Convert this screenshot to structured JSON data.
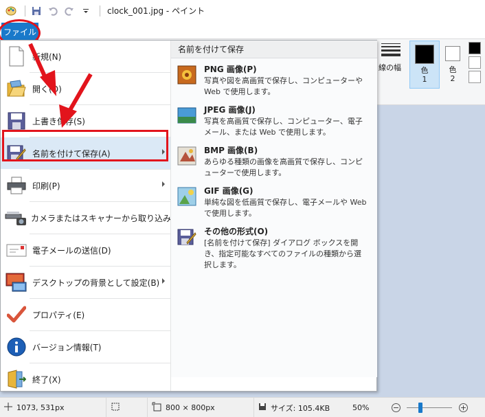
{
  "window": {
    "title": "clock_001.jpg - ペイント"
  },
  "ribbon": {
    "line_width_label": "線の幅",
    "color1_label": "色",
    "color1_num": "1",
    "color2_label": "色",
    "color2_num": "2"
  },
  "file_tab": {
    "label": "ファイル"
  },
  "menu": {
    "items": [
      {
        "label": "新規(N)",
        "icon": "new-file-icon"
      },
      {
        "label": "開く(O)",
        "icon": "open-folder-icon"
      },
      {
        "label": "上書き保存(S)",
        "icon": "save-icon"
      },
      {
        "label": "名前を付けて保存(A)",
        "icon": "save-as-icon",
        "submenu": true,
        "selected": true
      },
      {
        "label": "印刷(P)",
        "icon": "printer-icon",
        "submenu": true
      },
      {
        "label": "カメラまたはスキャナーから取り込み(M)",
        "icon": "scanner-icon"
      },
      {
        "label": "電子メールの送信(D)",
        "icon": "email-icon"
      },
      {
        "label": "デスクトップの背景として設定(B)",
        "icon": "desktop-background-icon",
        "submenu": true
      },
      {
        "label": "プロパティ(E)",
        "icon": "checkmark-icon"
      },
      {
        "label": "バージョン情報(T)",
        "icon": "info-icon"
      },
      {
        "label": "終了(X)",
        "icon": "exit-icon"
      }
    ]
  },
  "submenu": {
    "header": "名前を付けて保存",
    "items": [
      {
        "title": "PNG 画像(P)",
        "desc": "写真や図を高画質で保存し、コンピューターや Web で使用します。",
        "icon": "png-image-icon"
      },
      {
        "title": "JPEG 画像(J)",
        "desc": "写真を高画質で保存し、コンピューター、電子メール、または Web で使用します。",
        "icon": "jpeg-image-icon"
      },
      {
        "title": "BMP 画像(B)",
        "desc": "あらゆる種類の画像を高画質で保存し、コンピューターで使用します。",
        "icon": "bmp-image-icon"
      },
      {
        "title": "GIF 画像(G)",
        "desc": "単純な図を低画質で保存し、電子メールや Web で使用します。",
        "icon": "gif-image-icon"
      },
      {
        "title": "その他の形式(O)",
        "desc": "[名前を付けて保存] ダイアログ ボックスを開き、指定可能なすべてのファイルの種類から選択します。",
        "icon": "other-format-icon"
      }
    ]
  },
  "status": {
    "cursor_pos": "1073, 531px",
    "canvas_size": "800 × 800px",
    "file_size": "サイズ: 105.4KB",
    "zoom": "50%",
    "zoom_fraction": 0.5
  },
  "colors": {
    "accent": "#1979ca",
    "annotation_red": "#e2141c"
  }
}
